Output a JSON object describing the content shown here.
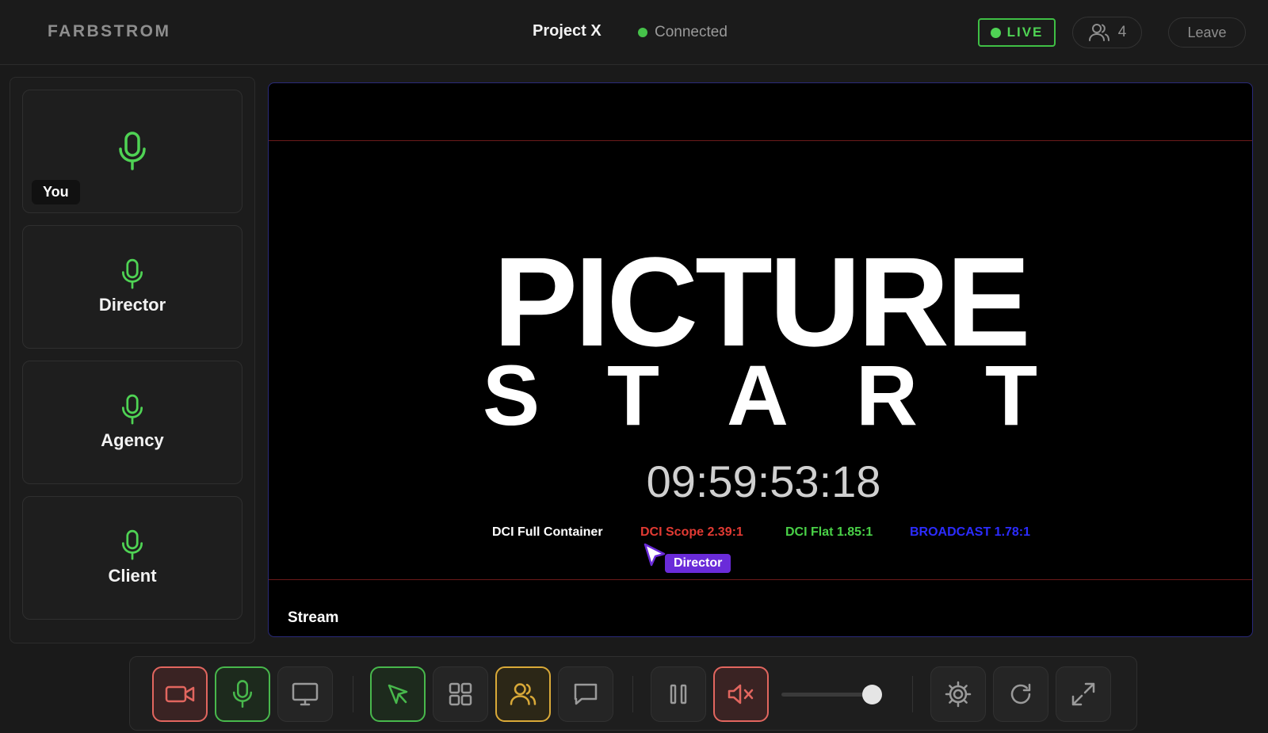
{
  "header": {
    "brand": "FARBSTROM",
    "project": "Project X",
    "connection_status": "Connected",
    "live_label": "LIVE",
    "participant_count": "4",
    "leave_label": "Leave"
  },
  "sidebar": {
    "tiles": [
      {
        "label": "You",
        "icon": "microphone-icon"
      },
      {
        "label": "Director",
        "icon": "microphone-icon"
      },
      {
        "label": "Agency",
        "icon": "microphone-icon"
      },
      {
        "label": "Client",
        "icon": "microphone-icon"
      }
    ]
  },
  "stage": {
    "title_line1": "PICTURE",
    "title_line2": [
      "S",
      "T",
      "A",
      "R",
      "T"
    ],
    "timecode": "09:59:53:18",
    "formats": [
      {
        "label": "DCI Full Container",
        "color": "#ffffff"
      },
      {
        "label": "DCI Scope 2.39:1",
        "color": "#e23a33"
      },
      {
        "label": "DCI Flat 1.85:1",
        "color": "#49d147"
      },
      {
        "label": "BROADCAST 1.78:1",
        "color": "#2c2cff"
      }
    ],
    "cursor_label": "Director",
    "stream_label": "Stream"
  },
  "toolbar": {
    "buttons": [
      {
        "name": "camera-button",
        "icon": "camera-icon",
        "state": "off"
      },
      {
        "name": "mic-button",
        "icon": "microphone-icon",
        "state": "on"
      },
      {
        "name": "screen-share-button",
        "icon": "monitor-icon"
      },
      {
        "name": "pointer-button",
        "icon": "cursor-icon",
        "state": "active"
      },
      {
        "name": "grid-button",
        "icon": "grid-icon"
      },
      {
        "name": "participants-button",
        "icon": "users-icon",
        "state": "active"
      },
      {
        "name": "chat-button",
        "icon": "chat-icon"
      },
      {
        "name": "pause-button",
        "icon": "pause-icon"
      },
      {
        "name": "mute-button",
        "icon": "speaker-muted-icon",
        "state": "muted"
      },
      {
        "name": "settings-button",
        "icon": "gear-icon"
      },
      {
        "name": "refresh-button",
        "icon": "refresh-icon"
      },
      {
        "name": "fullscreen-button",
        "icon": "expand-icon"
      }
    ],
    "volume_level": 0.91
  },
  "colors": {
    "accent_green": "#48b84c",
    "accent_red": "#e2665f",
    "accent_yellow": "#d9a938",
    "cursor_purple": "#6a2bd9"
  }
}
